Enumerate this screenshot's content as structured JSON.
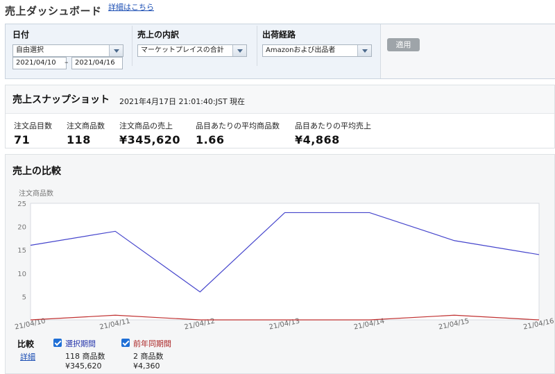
{
  "header": {
    "title": "売上ダッシュボード",
    "detail_link": "詳細はこちら"
  },
  "filters": {
    "date": {
      "label": "日付",
      "mode": "自由選択",
      "from": "2021/04/10",
      "to": "2021/04/16",
      "separator": "–"
    },
    "breakdown": {
      "label": "売上の内訳",
      "value": "マーケットプレイスの合計"
    },
    "channel": {
      "label": "出荷経路",
      "value": "Amazonおよび出品者"
    },
    "apply_label": "適用"
  },
  "snapshot": {
    "title": "売上スナップショット",
    "timestamp": "2021年4月17日 21:01:40:JST 現在",
    "metrics": [
      {
        "label": "注文品目数",
        "value": "71"
      },
      {
        "label": "注文商品数",
        "value": "118"
      },
      {
        "label": "注文商品の売上",
        "value": "¥345,620"
      },
      {
        "label": "品目あたりの平均商品数",
        "value": "1.66"
      },
      {
        "label": "品目あたりの平均売上",
        "value": "¥4,868"
      }
    ]
  },
  "comparison": {
    "title": "売上の比較",
    "legend_heading": "比較",
    "legend_link": "詳細",
    "series": [
      {
        "name": "選択期間",
        "count": "118 商品数",
        "sales": "¥345,620",
        "color": "#4444cc"
      },
      {
        "name": "前年同期間",
        "count": "2 商品数",
        "sales": "¥4,360",
        "color": "#c03030"
      }
    ]
  },
  "chart_data": {
    "type": "line",
    "ylabel": "注文商品数",
    "ylim": [
      0,
      25
    ],
    "yticks": [
      5,
      10,
      15,
      20,
      25
    ],
    "categories": [
      "21/04/10",
      "21/04/11",
      "21/04/12",
      "21/04/13",
      "21/04/14",
      "21/04/15",
      "21/04/16"
    ],
    "series": [
      {
        "name": "選択期間",
        "values": [
          16,
          19,
          6,
          23,
          23,
          17,
          14
        ],
        "color": "#4444cc"
      },
      {
        "name": "前年同期間",
        "values": [
          0,
          1,
          0,
          0,
          0,
          1,
          0
        ],
        "color": "#c03030"
      }
    ]
  }
}
